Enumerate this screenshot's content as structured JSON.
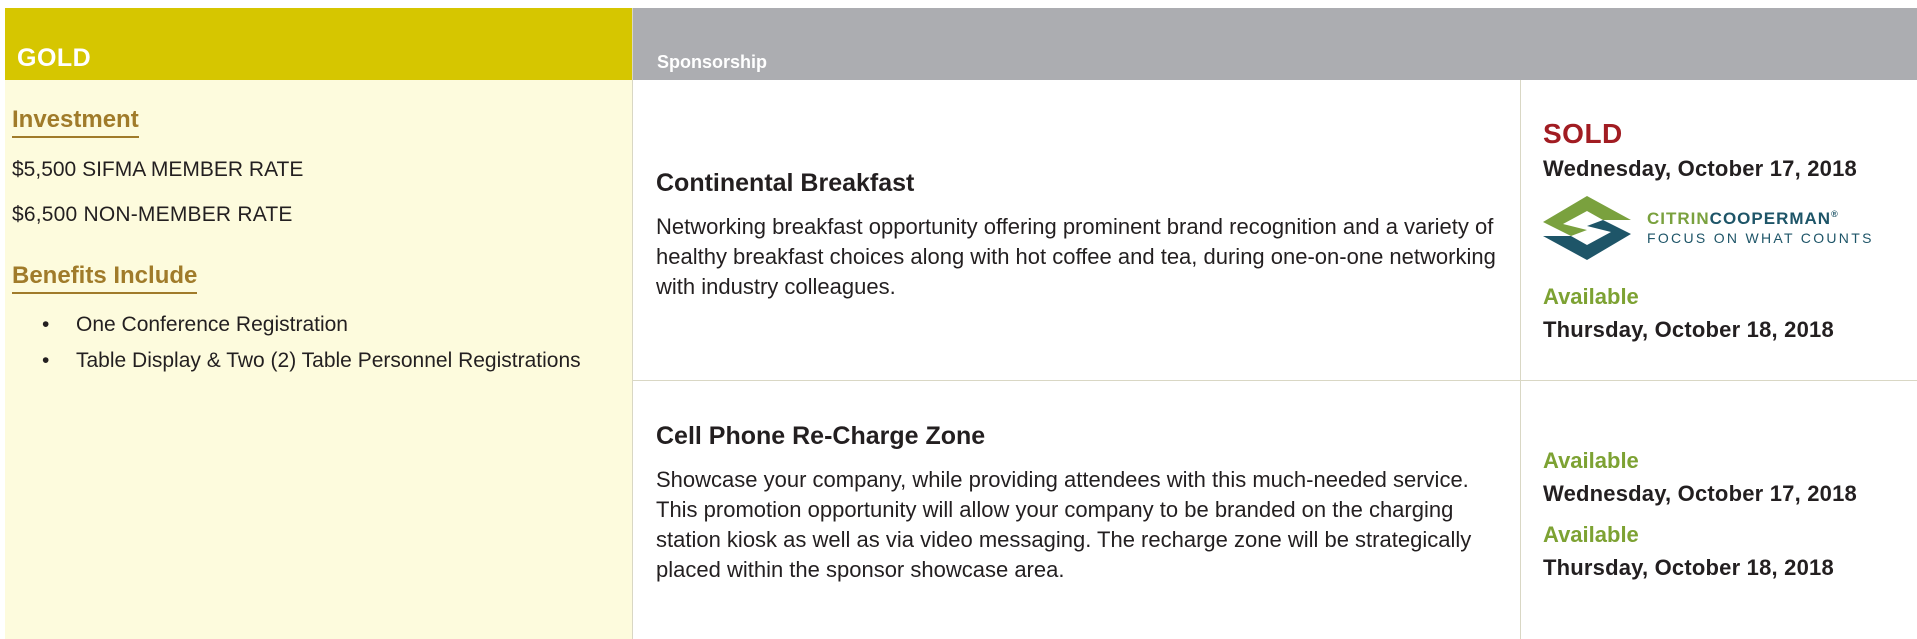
{
  "left": {
    "tier_title": "GOLD",
    "investment_heading": "Investment",
    "member_rate": "$5,500 SIFMA MEMBER RATE",
    "non_member_rate": "$6,500 NON-MEMBER RATE",
    "benefits_heading": "Benefits Include",
    "benefits": [
      "One Conference Registration",
      "Table Display & Two (2) Table Personnel Registrations"
    ],
    "bullet": "•"
  },
  "right": {
    "header_title": "Sponsorship"
  },
  "sponsorships": [
    {
      "title": "Continental Breakfast",
      "description": "Networking breakfast opportunity offering prominent brand recognition and a variety of healthy breakfast choices along with hot coffee and tea, during one-on-one networking with industry colleagues.",
      "slots": [
        {
          "status": "SOLD",
          "date": "Wednesday, October 17, 2018"
        },
        {
          "status": "Available",
          "date": "Thursday, October 18, 2018"
        }
      ],
      "sponsor_logo": {
        "brand_part1": "CITRIN",
        "brand_part2": "COOPERMAN",
        "registered": "®",
        "tagline": "FOCUS ON WHAT COUNTS"
      }
    },
    {
      "title": "Cell Phone Re-Charge Zone",
      "description": "Showcase your company, while providing attendees with this much-needed service. This promotion opportunity will allow your company to be branded on the charging station kiosk as well as via video messaging. The recharge zone will be strategically placed within the sponsor showcase area.",
      "slots": [
        {
          "status": "Available",
          "date": "Wednesday, October 17, 2018"
        },
        {
          "status": "Available",
          "date": "Thursday, October 18, 2018"
        }
      ]
    }
  ],
  "colors": {
    "gold_header": "#d6c600",
    "left_panel_bg": "#fdfbdd",
    "right_header": "#acadb1",
    "heading_gold": "#a07b2a",
    "sold_red": "#a11c22",
    "available_green": "#7da233",
    "logo_green": "#7aa13e",
    "logo_navy": "#1e5568"
  },
  "icons": {
    "sponsor_logo_mark": "citrin-cooperman-logo-icon"
  }
}
